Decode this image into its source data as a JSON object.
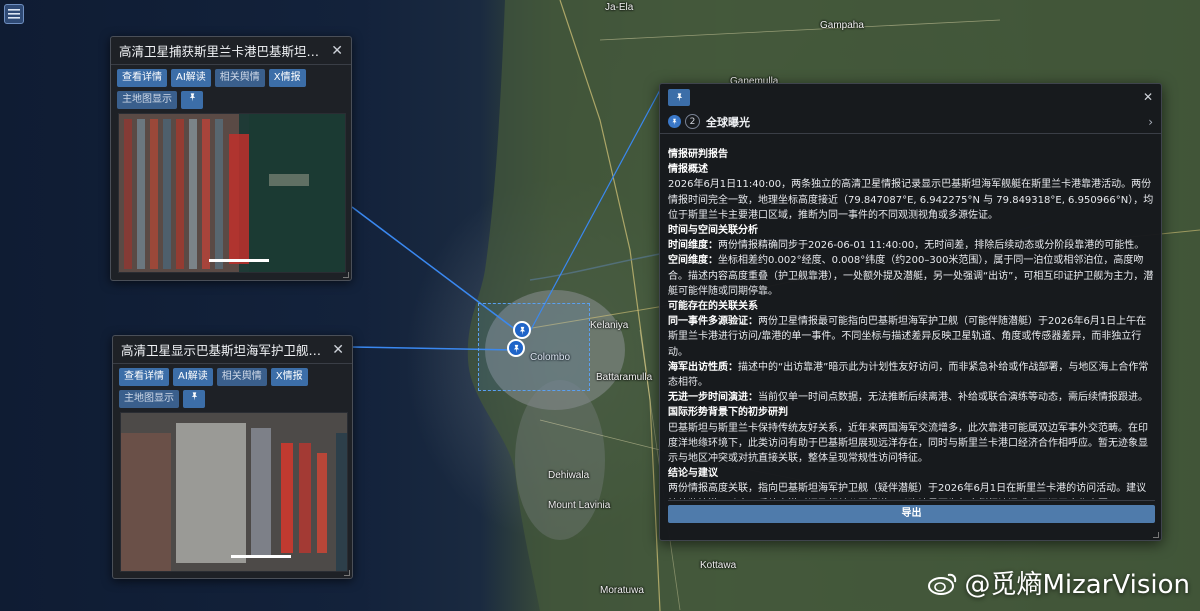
{
  "map": {
    "labels": [
      "Ja-Ela",
      "Gampaha",
      "Ganemulla",
      "Kelaniya",
      "Colombo",
      "Kottawa",
      "Moratuwa",
      "Battaramulla",
      "Dehiwala",
      "Mount Lavinia"
    ]
  },
  "menu": {
    "icon": "menu-icon"
  },
  "card1": {
    "title": "高清卫星捕获斯里兰卡港巴基斯坦护卫…",
    "buttons": [
      "查看详情",
      "AI解读",
      "相关舆情",
      "X情报"
    ],
    "map_button": "主地图显示"
  },
  "card2": {
    "title": "高清卫星显示巴基斯坦海军护卫舰和潜…",
    "buttons": [
      "查看详情",
      "AI解读",
      "相关舆情",
      "X情报"
    ],
    "map_button": "主地图显示"
  },
  "report": {
    "exposure_count": "2",
    "exposure_title": "全球曝光",
    "h_report": "情报研判报告",
    "h_overview": "情报概述",
    "overview": "2026年6月1日11:40:00，两条独立的高清卫星情报记录显示巴基斯坦海军舰艇在斯里兰卡港靠港活动。两份情报时间完全一致，地理坐标高度接近（79.847087°E, 6.942275°N 与 79.849318°E, 6.950966°N），均位于斯里兰卡主要港口区域，推断为同一事件的不同观测视角或多源佐证。",
    "h_spacetime": "时间与空间关联分析",
    "time_label": "时间维度：",
    "time_text": "两份情报精确同步于2026-06-01 11:40:00，无时间差，排除后续动态或分阶段靠港的可能性。",
    "space_label": "空间维度：",
    "space_text": "坐标相差约0.002°经度、0.008°纬度（约200–300米范围），属于同一泊位或相邻泊位，高度吻合。描述内容高度重叠（护卫舰靠港），一处额外提及潜艇，另一处强调“出访”，可相互印证护卫舰为主力，潜艇可能伴随或同期停靠。",
    "h_relations": "可能存在的关联关系",
    "rel1_label": "同一事件多源验证：",
    "rel1_text": "两份卫星情报最可能指向巴基斯坦海军护卫舰（可能伴随潜艇）于2026年6月1日上午在斯里兰卡港进行访问/靠港的单一事件。不同坐标与描述差异反映卫星轨道、角度或传感器差异，而非独立行动。",
    "rel2_label": "海军出访性质：",
    "rel2_text": "描述中的“出访靠港”暗示此为计划性友好访问，而非紧急补给或作战部署，与地区海上合作常态相符。",
    "rel3_label": "无进一步时间演进：",
    "rel3_text": "当前仅单一时间点数据，无法推断后续离港、补给或联合演练等动态，需后续情报跟进。",
    "h_geo": "国际形势背景下的初步研判",
    "geo_text": "巴基斯坦与斯里兰卡保持传统友好关系，近年来两国海军交流增多，此次靠港可能属双边军事外交范畴。在印度洋地缘环境下，此类访问有助于巴基斯坦展现远洋存在，同时与斯里兰卡港口经济合作相呼应。暂无迹象显示与地区冲突或对抗直接关联，整体呈现常规性访问特征。",
    "h_conclusion": "结论与建议",
    "conclusion_text": "两份情报高度关联，指向巴基斯坦海军护卫舰（疑伴潜艇）于2026年6月1日在斯里兰卡港的访问活动。建议持续监控港口动态、后续离港时间及相关公开报道，以确认是否为年度例行访问或有更深层合作意图。",
    "export_label": "导出"
  },
  "watermark": {
    "text": "@觅熵MizarVision"
  },
  "colors": {
    "accent": "#3c6ea8",
    "panel": "#1e2126",
    "selection": "#5aa0f0"
  }
}
